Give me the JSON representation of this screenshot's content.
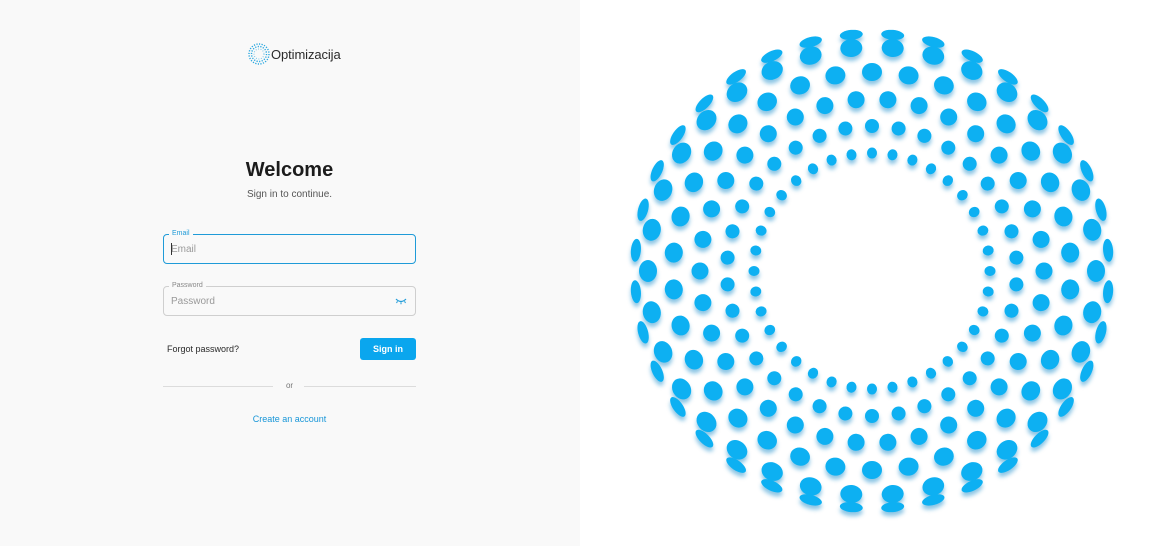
{
  "brand": {
    "name": "Optimizacija",
    "logo_icon": "dotted-ring-logo-icon"
  },
  "login": {
    "title": "Welcome",
    "subtitle": "Sign in to continue.",
    "email": {
      "label": "Email",
      "placeholder": "Email",
      "value": ""
    },
    "password": {
      "label": "Password",
      "placeholder": "Password",
      "value": "",
      "toggle_icon": "eye-closed-icon"
    },
    "forgot_label": "Forgot password?",
    "signin_label": "Sign in",
    "or_label": "or",
    "create_label": "Create an account"
  },
  "colors": {
    "accent": "#0aa6ee",
    "link": "#1896d8",
    "focus_border": "#1f9bd8",
    "left_panel_bg": "#f9f9f9",
    "art_dots": "#0ab0f2"
  }
}
